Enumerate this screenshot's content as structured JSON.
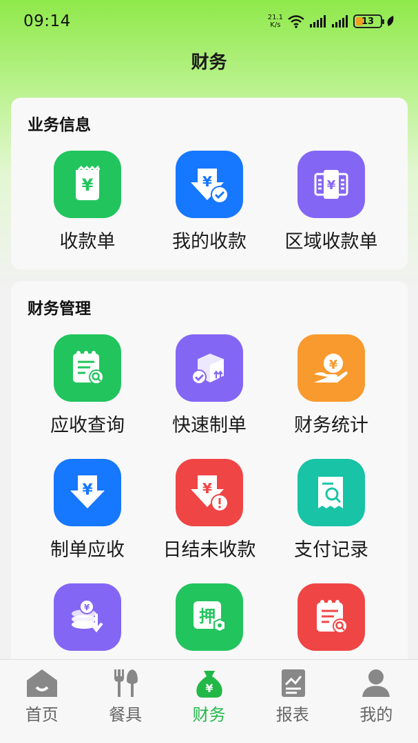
{
  "status": {
    "time": "09:14",
    "netspeed_value": "21.1",
    "netspeed_unit": "K/s",
    "battery": "13"
  },
  "header": {
    "title": "财务"
  },
  "business": {
    "title": "业务信息",
    "items": [
      {
        "label": "收款单",
        "icon": "receipt-yuan-icon",
        "color": "#22c45e"
      },
      {
        "label": "我的收款",
        "icon": "yuan-down-check-icon",
        "color": "#1677ff"
      },
      {
        "label": "区域收款单",
        "icon": "banknote-yuan-icon",
        "color": "#8466f5"
      }
    ]
  },
  "finance": {
    "title": "财务管理",
    "items": [
      {
        "label": "应收查询",
        "icon": "notepad-search-icon",
        "color": "#22c45e"
      },
      {
        "label": "快速制单",
        "icon": "box-check-icon",
        "color": "#8466f5"
      },
      {
        "label": "财务统计",
        "icon": "hand-coin-icon",
        "color": "#f99a2e"
      },
      {
        "label": "制单应收",
        "icon": "yuan-down-arrow-icon",
        "color": "#1677ff"
      },
      {
        "label": "日结未收款",
        "icon": "yuan-down-warning-icon",
        "color": "#f04545"
      },
      {
        "label": "支付记录",
        "icon": "receipt-search-icon",
        "color": "#18c3a6"
      },
      {
        "label": "",
        "icon": "coins-down-icon",
        "color": "#8466f5"
      },
      {
        "label": "",
        "icon": "deposit-settings-icon",
        "color": "#22c45e"
      },
      {
        "label": "",
        "icon": "notepad-search-icon",
        "color": "#f04545"
      }
    ]
  },
  "tabbar": {
    "tabs": [
      {
        "label": "首页",
        "icon": "home-icon"
      },
      {
        "label": "餐具",
        "icon": "cutlery-icon"
      },
      {
        "label": "财务",
        "icon": "money-bag-icon",
        "active": true
      },
      {
        "label": "报表",
        "icon": "report-chart-icon"
      },
      {
        "label": "我的",
        "icon": "user-icon"
      }
    ],
    "active_color": "#22b848"
  }
}
